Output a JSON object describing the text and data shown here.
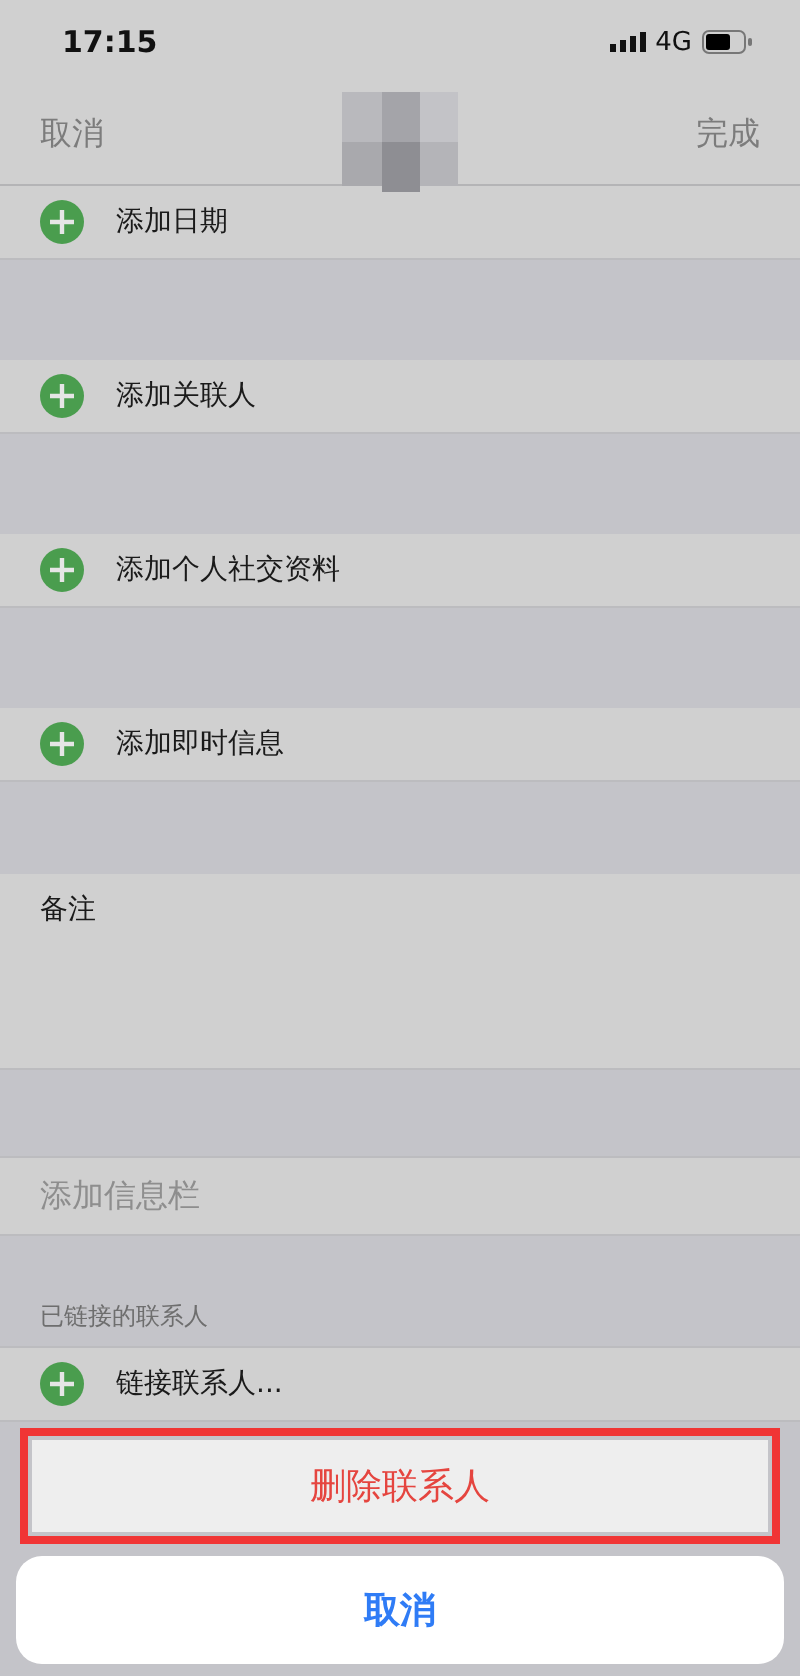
{
  "status_bar": {
    "time": "17:15",
    "network": "4G"
  },
  "nav": {
    "cancel": "取消",
    "done": "完成"
  },
  "sections": [
    {
      "kind": "add",
      "label": "添加日期"
    },
    {
      "kind": "add",
      "label": "添加关联人"
    },
    {
      "kind": "add",
      "label": "添加个人社交资料"
    },
    {
      "kind": "add",
      "label": "添加即时信息"
    },
    {
      "kind": "note",
      "label": "备注"
    },
    {
      "kind": "field",
      "label": "添加信息栏"
    },
    {
      "kind": "header",
      "label": "已链接的联系人"
    },
    {
      "kind": "add",
      "label": "链接联系人..."
    }
  ],
  "action_sheet": {
    "buttons": [
      {
        "label": "删除联系人",
        "kind": "destructive",
        "highlighted": true
      },
      {
        "label": "取消",
        "kind": "cancel",
        "highlighted": false
      }
    ]
  }
}
